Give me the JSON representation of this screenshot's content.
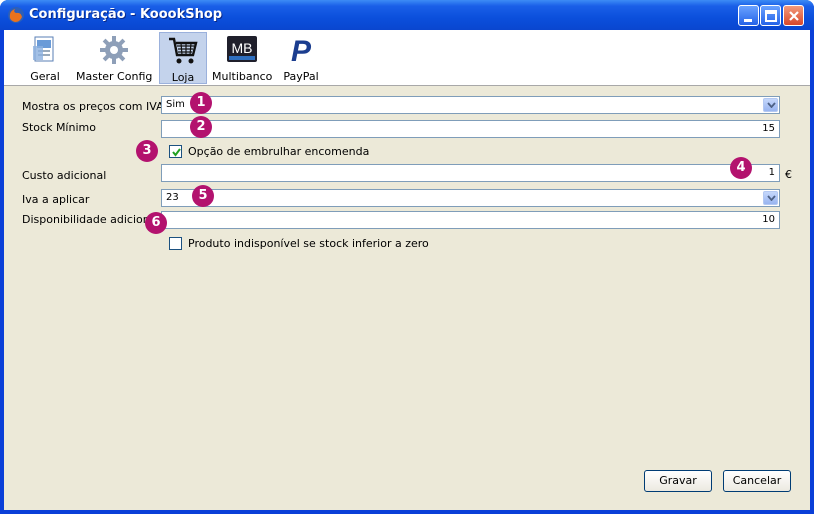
{
  "window": {
    "title": "Configuração - KoookShop"
  },
  "toolbar": {
    "items": [
      {
        "label": "Geral",
        "icon": "document-icon"
      },
      {
        "label": "Master Config",
        "icon": "gear-icon"
      },
      {
        "label": "Loja",
        "icon": "cart-icon",
        "active": true
      },
      {
        "label": "Multibanco",
        "icon": "multibanco-icon"
      },
      {
        "label": "PayPal",
        "icon": "paypal-icon"
      }
    ],
    "multibanco_logo_text": "MB",
    "paypal_logo_text": "P"
  },
  "form": {
    "mostra_precos": {
      "label": "Mostra os preços com IVA?",
      "value": "Sim"
    },
    "stock_minimo": {
      "label": "Stock Mínimo",
      "value": "15"
    },
    "embrulhar": {
      "label": "Opção de embrulhar encomenda",
      "checked": true
    },
    "custo_adicional": {
      "label": "Custo adicional",
      "value": "1",
      "unit": "€"
    },
    "iva": {
      "label": "Iva a aplicar",
      "value": "23"
    },
    "disponibilidade": {
      "label": "Disponibilidade adicional",
      "value": "10"
    },
    "produto_indisponivel": {
      "label": "Produto indisponível se stock inferior a zero",
      "checked": false
    }
  },
  "badges": [
    "1",
    "2",
    "3",
    "4",
    "5",
    "6"
  ],
  "buttons": {
    "save": "Gravar",
    "cancel": "Cancelar"
  },
  "colors": {
    "badge": "#b3126e",
    "titlebar": "#0b4fdc",
    "background": "#ece9d8"
  }
}
